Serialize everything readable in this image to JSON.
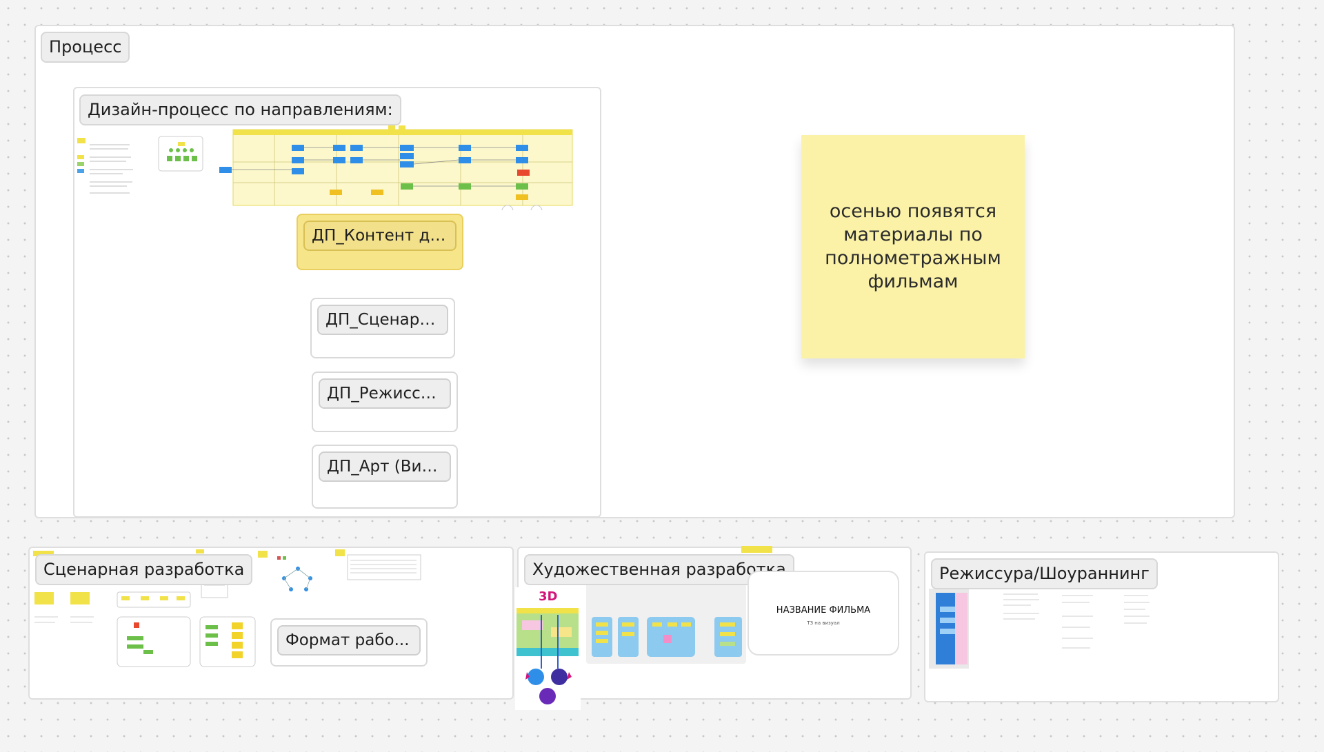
{
  "frames": {
    "process": "Процесс",
    "design_process": "Дизайн-процесс по направлениям:",
    "scenario": "Сценарная разработка",
    "art": "Художественная разработка",
    "directing": "Режиссура/Шоураннинг"
  },
  "cards": {
    "content": "ДП_Контент де...",
    "script": "ДП_Сценарн...",
    "director": "ДП_Режиссе...",
    "art": "ДП_Арт (Виз...",
    "format": "Формат рабо..."
  },
  "sticky_note": "осенью появятся материалы по полнометражным фильмам",
  "thumbnails": {
    "badge_3d": "3D",
    "film_title": "НАЗВАНИЕ ФИЛЬМА",
    "film_subtitle": "ТЗ на визуал"
  },
  "colors": {
    "sticky": "#fbf2a8",
    "highlight_card": "#f7e58a",
    "accent_blue": "#2f8fe8",
    "accent_magenta": "#d1147a"
  }
}
